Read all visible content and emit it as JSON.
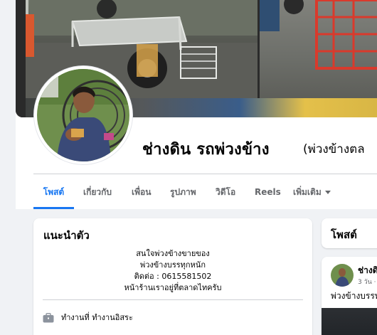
{
  "profile": {
    "name": "ช่างดิน รถพ่วงข้าง",
    "alternate_name": "(พ่วงข้างตล"
  },
  "tabs": [
    {
      "label": "โพสต์",
      "active": true
    },
    {
      "label": "เกี่ยวกับ",
      "active": false
    },
    {
      "label": "เพื่อน",
      "active": false
    },
    {
      "label": "รูปภาพ",
      "active": false
    },
    {
      "label": "วิดีโอ",
      "active": false
    },
    {
      "label": "Reels",
      "active": false
    },
    {
      "label": "เพิ่มเติม",
      "active": false
    }
  ],
  "intro": {
    "title": "แนะนำตัว",
    "bio_lines": [
      "สนใจพ่วงข้างขายของ",
      "พ่วงข้างบรรทุกหนัก",
      "ติดต่อ : 0615581502",
      "หน้าร้านเราอยู่ที่ตลาดไทครับ"
    ],
    "work": "ทำงานที่ ทำงานอิสระ",
    "work_icon": "briefcase-icon"
  },
  "posts": {
    "title": "โพสต์",
    "first_post": {
      "author": "ช่างดิ",
      "time": "3 วัน ·",
      "text": "พ่วงข้างบรรทุ"
    }
  },
  "colors": {
    "accent": "#1877f2",
    "background": "#f0f2f5",
    "secondary_text": "#65676b"
  }
}
